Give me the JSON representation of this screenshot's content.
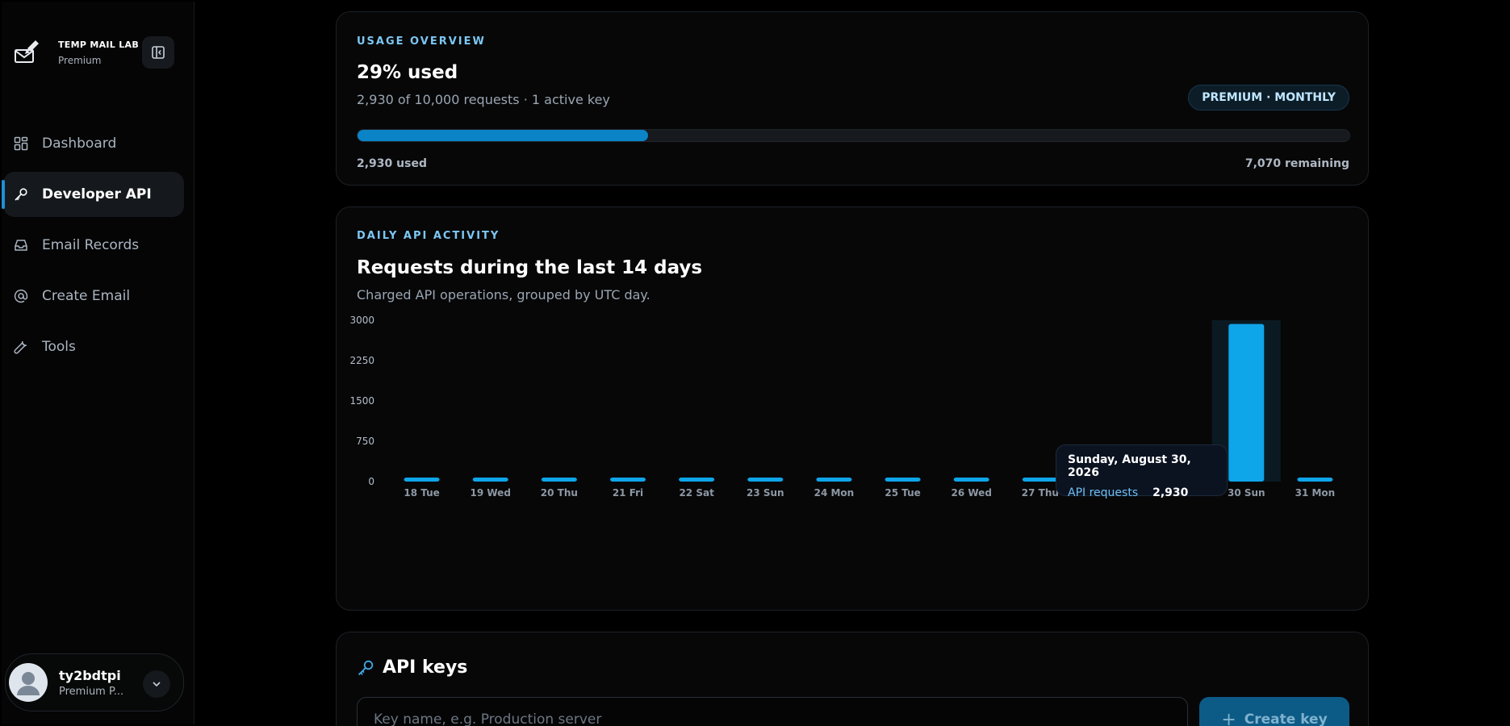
{
  "brand": {
    "title": "TEMP MAIL LAB",
    "plan": "Premium"
  },
  "nav": {
    "items": [
      {
        "label": "Dashboard",
        "icon": "grid-icon",
        "active": false
      },
      {
        "label": "Developer API",
        "icon": "key-icon",
        "active": true
      },
      {
        "label": "Email Records",
        "icon": "inbox-icon",
        "active": false
      },
      {
        "label": "Create Email",
        "icon": "at-icon",
        "active": false
      },
      {
        "label": "Tools",
        "icon": "wrench-icon",
        "active": false
      }
    ]
  },
  "user": {
    "name": "ty2bdtpi",
    "plan": "Premium P..."
  },
  "usage": {
    "eyebrow": "USAGE OVERVIEW",
    "title": "29% used",
    "subtitle": "2,930 of 10,000 requests · 1 active key",
    "badge": "PREMIUM · MONTHLY",
    "used_label": "2,930 used",
    "remaining_label": "7,070 remaining",
    "fraction_used": 0.293
  },
  "activity": {
    "eyebrow": "DAILY API ACTIVITY",
    "title": "Requests during the last 14 days",
    "subtitle": "Charged API operations, grouped by UTC day.",
    "tooltip": {
      "title": "Sunday, August 30, 2026",
      "key": "API requests",
      "value": "2,930"
    }
  },
  "chart_data": {
    "type": "bar",
    "categories": [
      "18 Tue",
      "19 Wed",
      "20 Thu",
      "21 Fri",
      "22 Sat",
      "23 Sun",
      "24 Mon",
      "25 Tue",
      "26 Wed",
      "27 Thu",
      "28 Fri",
      "29 Sat",
      "30 Sun",
      "31 Mon"
    ],
    "values": [
      0,
      0,
      0,
      0,
      0,
      0,
      0,
      0,
      0,
      0,
      0,
      0,
      2930,
      0
    ],
    "yticks": [
      0,
      750,
      1500,
      2250,
      3000
    ],
    "ylim": [
      0,
      3000
    ],
    "highlighted_index": 12,
    "bar_color": "#0ea5e9"
  },
  "keys": {
    "title": "API keys",
    "input_placeholder": "Key name, e.g. Production server",
    "create_label": "Create key"
  }
}
